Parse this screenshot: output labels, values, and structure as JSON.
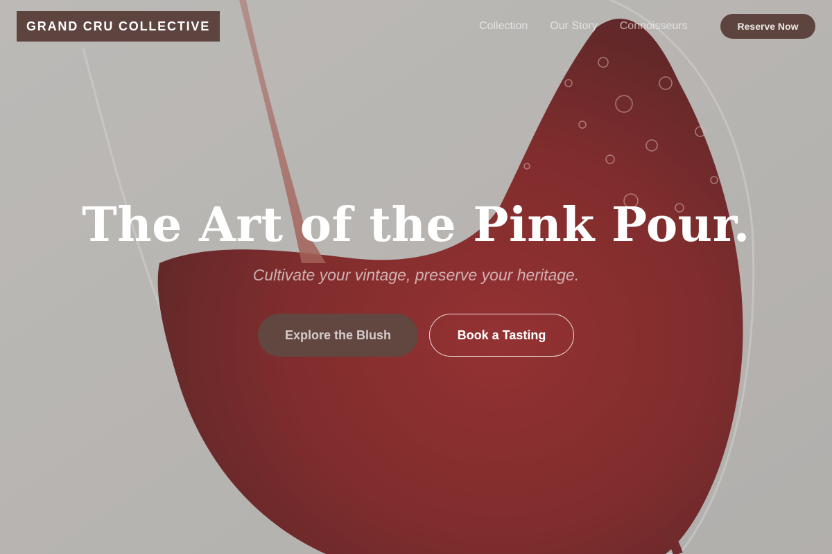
{
  "header": {
    "brand": "GRAND CRU COLLECTIVE",
    "nav": [
      {
        "label": "Collection"
      },
      {
        "label": "Our Story"
      },
      {
        "label": "Connoisseurs"
      }
    ],
    "reserve_label": "Reserve Now"
  },
  "hero": {
    "title": "The Art of the Pink Pour.",
    "subtitle": "Cultivate your vintage, preserve your heritage.",
    "primary_cta": "Explore the Blush",
    "secondary_cta": "Book a Tasting",
    "background_image": "red wine pouring into tilted glass"
  },
  "colors": {
    "brand": "#5e443e",
    "wine": "#8e1414",
    "background": "#cfcdca",
    "text": "#ffffff"
  }
}
